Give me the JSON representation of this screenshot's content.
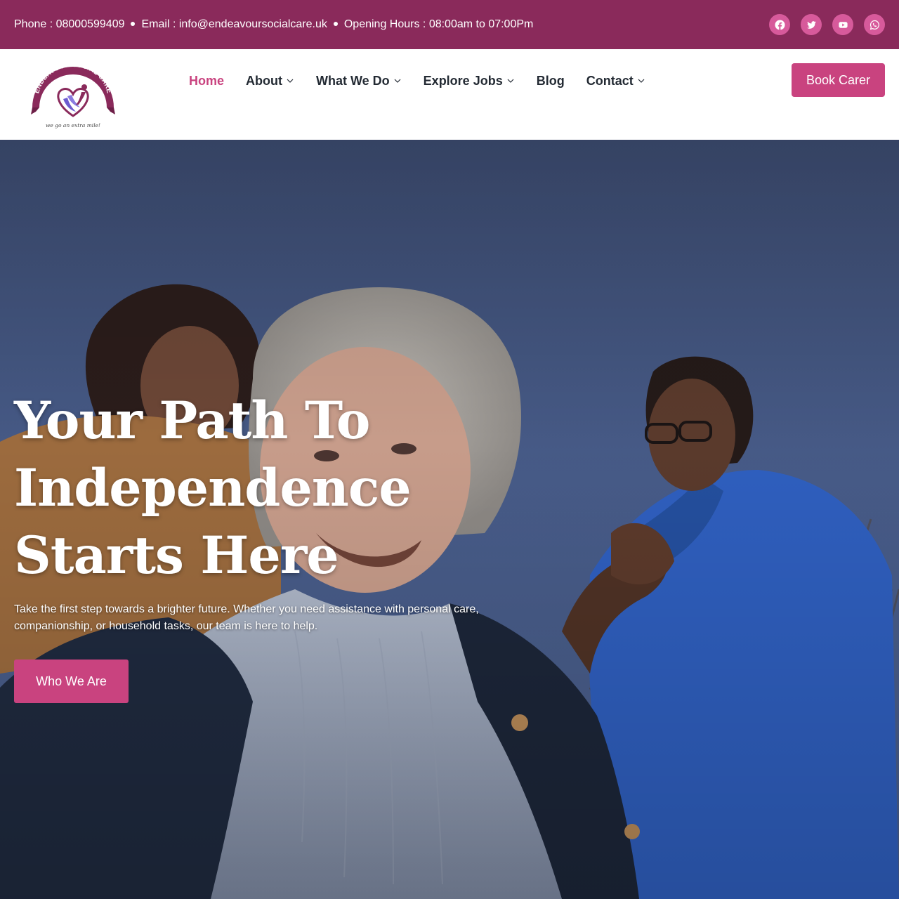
{
  "topbar": {
    "phone": "Phone : 08000599409",
    "email": "Email : info@endeavoursocialcare.uk",
    "hours": "Opening Hours : 08:00am to 07:00Pm",
    "socials": [
      "facebook-icon",
      "twitter-icon",
      "youtube-icon",
      "whatsapp-icon"
    ],
    "background_color": "#8a2a5b",
    "icon_color": "#d75a9b"
  },
  "logo": {
    "arc_text": "ENDEAVOUR SOCIAL CARE",
    "tagline": "we go an extra mile!"
  },
  "nav": {
    "items": [
      {
        "label": "Home",
        "active": true,
        "dropdown": false
      },
      {
        "label": "About",
        "active": false,
        "dropdown": true
      },
      {
        "label": "What We Do",
        "active": false,
        "dropdown": true
      },
      {
        "label": "Explore Jobs",
        "active": false,
        "dropdown": true
      },
      {
        "label": "Blog",
        "active": false,
        "dropdown": false
      },
      {
        "label": "Contact",
        "active": false,
        "dropdown": true
      }
    ],
    "cta": "Book Carer",
    "accent_color": "#c9437f"
  },
  "hero": {
    "title_lines": [
      "Your Path To",
      "Independence",
      "Starts Here"
    ],
    "text_lines": [
      "Take the first step towards a brighter future. Whether you need assistance with personal care,",
      "companionship, or household tasks, our team is here to help."
    ],
    "button": "Who We Are",
    "image": "photo of an elderly woman smiling outdoors with two carers under a blue sky"
  }
}
